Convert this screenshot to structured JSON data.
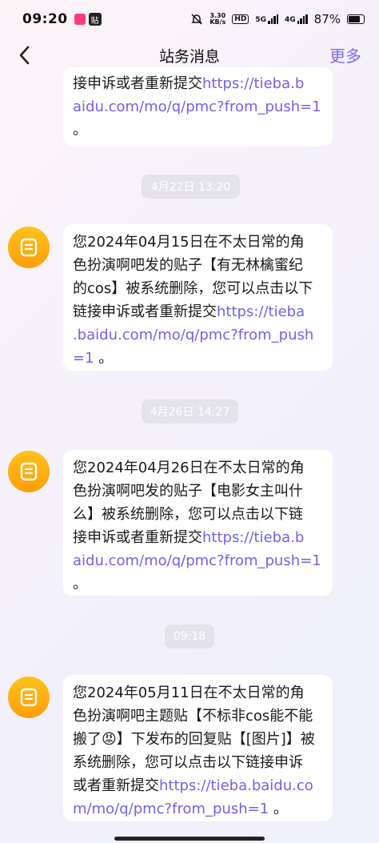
{
  "status_bar": {
    "time": "09:20",
    "app2_label": "贴",
    "net_speed_value": "3.30",
    "net_speed_unit": "KB/s",
    "hd_badge": "HD",
    "signal_5g": "5G",
    "signal_4g": "4G",
    "battery": "87%"
  },
  "nav": {
    "title": "站务消息",
    "more_label": "更多"
  },
  "messages": [
    {
      "text_lines": [
        "接申诉或者重新提交"
      ],
      "link_lines": [
        "https://tieba.b",
        "aidu.com/mo/q/pmc?from_push=1"
      ],
      "end": "。"
    },
    {
      "timestamp": "4月22日 13:20",
      "line1": "您2024年04月15日在不太日常的角",
      "line2": "色扮演啊吧发的贴子【有无林檎蜜纪",
      "line3": "的cos】被系统删除，您可以点击以下",
      "line4_prefix": "链接申诉或者重新提交",
      "line4_link": "https://tieba",
      "line5_link": ".baidu.com/mo/q/pmc?from_push",
      "line6_link": "=1",
      "end": " 。"
    },
    {
      "timestamp": "4月26日 14:27",
      "line1": "您2024年04月26日在不太日常的角",
      "line2": "色扮演啊吧发的贴子【电影女主叫什",
      "line3": "么】被系统删除，您可以点击以下链",
      "line4_prefix": "接申诉或者重新提交",
      "line4_link": "https://tieba.b",
      "line5_link": "aidu.com/mo/q/pmc?from_push=1",
      "end": "。"
    },
    {
      "timestamp": "09:18",
      "line1": "您2024年05月11日在不太日常的角",
      "line2": "色扮演啊吧主题贴【不标非cos能不能",
      "line3_prefix": "搬了",
      "line3_emoji": "😡",
      "line3_suffix": "】下发布的回复贴【[图片]】被",
      "line4": "系统删除，您可以点击以下链接申诉",
      "line5_prefix": "或者重新提交",
      "line5_link": "https://tieba.baidu.co",
      "line6_link": "m/mo/q/pmc?from_push=1",
      "end": " 。"
    }
  ],
  "colors": {
    "accent": "#7b6cf0",
    "link": "#7063e6",
    "avatar": "#ffb012"
  },
  "icons": {
    "back": "chevron-left-icon",
    "avatar": "document-icon"
  }
}
